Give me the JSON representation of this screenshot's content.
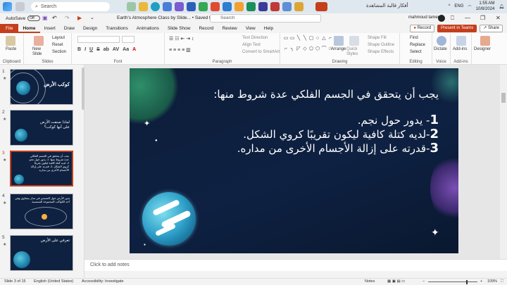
{
  "taskbar": {
    "search_placeholder": "Search",
    "tray_text": "أفكار قالبة المشاهدة",
    "lang": "ENG",
    "time": "1:55 AM",
    "date": "10/8/2024"
  },
  "titlebar": {
    "autosave_label": "AutoSave",
    "autosave_state": "Off",
    "doc_title": "Earth's Atmosphere Class by Slide...  •  Saved to this PC",
    "search_placeholder": "Search",
    "user_name": "mahmoud tamer"
  },
  "tabs": [
    "File",
    "Home",
    "Insert",
    "Draw",
    "Design",
    "Transitions",
    "Animations",
    "Slide Show",
    "Record",
    "Review",
    "View",
    "Help"
  ],
  "active_tab": "Home",
  "ribbon_buttons": {
    "record": "Record",
    "present_teams": "Present in Teams",
    "share": "Share"
  },
  "ribbon": {
    "clipboard": {
      "paste": "Paste",
      "name": "Clipboard"
    },
    "slides": {
      "new_slide": "New Slide",
      "layout": "Layout",
      "reset": "Reset",
      "section": "Section",
      "name": "Slides"
    },
    "font": {
      "name": "Font",
      "format": [
        "B",
        "I",
        "U",
        "S",
        "ab",
        "AV",
        "Aa",
        "A"
      ]
    },
    "paragraph": {
      "name": "Paragraph",
      "text_direction": "Text Direction",
      "align_text": "Align Text",
      "convert_smartart": "Convert to SmartArt"
    },
    "drawing": {
      "name": "Drawing",
      "arrange": "Arrange",
      "quick_styles": "Quick Styles",
      "shape_fill": "Shape Fill",
      "shape_outline": "Shape Outline",
      "shape_effects": "Shape Effects",
      "shapes": [
        "▭",
        "▭",
        "╲",
        "╲",
        "▢",
        "○",
        "△",
        "⌐",
        "⌐",
        "╮",
        "◸",
        "◇",
        "⬠",
        "⬡",
        "⌒",
        "☆"
      ]
    },
    "editing": {
      "name": "Editing",
      "find": "Find",
      "replace": "Replace",
      "select": "Select"
    },
    "voice": {
      "name": "Voice",
      "dictate": "Dictate"
    },
    "addins": {
      "name": "Add-ins",
      "label": "Add-ins"
    },
    "designer": {
      "label": "Designer"
    }
  },
  "thumbnails": [
    {
      "num": "1",
      "text": "كوكب الأرض"
    },
    {
      "num": "2",
      "text": "لماذا صنفت الأرض على أنها كوكب؟"
    },
    {
      "num": "3",
      "text": "يجب أن يتحقق في الجسم الفلكي عدة شروط منها: 1- يدور حول نجم. 2- لديه كتلة كافية ليكون تقريبًا كروي الشكل. 3- قدرته على إزالة الأجسام الأخرى من مداره."
    },
    {
      "num": "4",
      "text": "تدور الأرض حول الشمس في مدار بيضاوي وهي أحد الكواكب المجموعة الشمسية"
    },
    {
      "num": "5",
      "text": "تعرفي على الأرض"
    }
  ],
  "slide": {
    "line1": "يجب أن يتحقق في الجسم الفلكي عدة شروط منها:",
    "item1_num": "1",
    "item1_text": "- يدور حول نجم.",
    "item2_num": "2",
    "item2_text": "-لديه كتلة كافية ليكون تقريبًا كروي الشكل.",
    "item3_num": "3",
    "item3_text": "-قدرته على إزالة الأجسام الأخرى من مداره."
  },
  "notes_placeholder": "Click to add notes",
  "status": {
    "slide_of": "Slide 3 of 15",
    "language": "English (United States)",
    "accessibility": "Accessibility: Investigate",
    "notes": "Notes",
    "zoom": "109%"
  }
}
